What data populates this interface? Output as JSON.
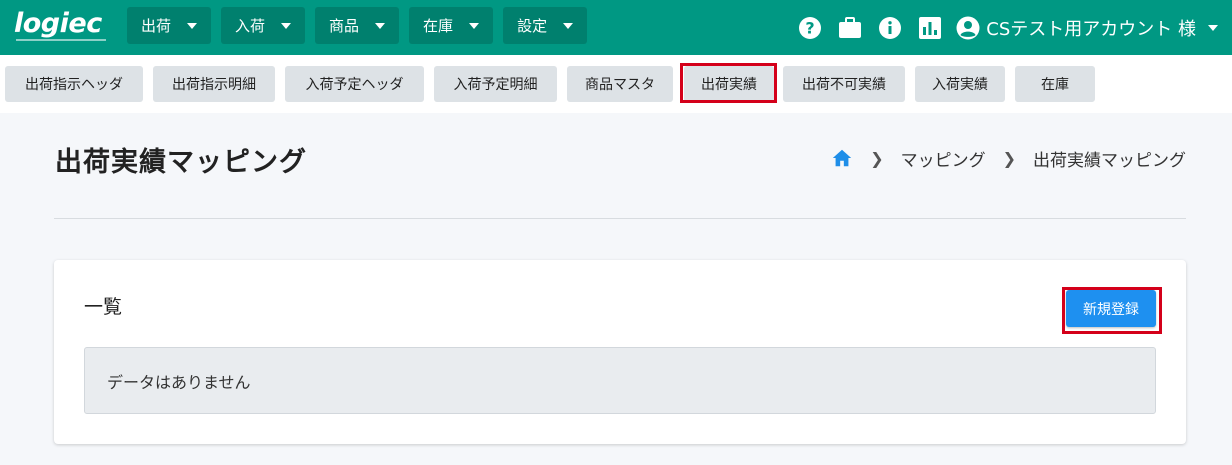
{
  "header": {
    "logo_text": "logiec",
    "menu": [
      {
        "label": "出荷"
      },
      {
        "label": "入荷"
      },
      {
        "label": "商品"
      },
      {
        "label": "在庫"
      },
      {
        "label": "設定"
      }
    ],
    "icons": [
      "help-icon",
      "briefcase-icon",
      "info-icon",
      "chart-icon",
      "account-icon"
    ],
    "user_name": "CSテスト用アカウント 様",
    "colors": {
      "bar": "#009883",
      "menu": "#00806e"
    }
  },
  "subtabs": [
    {
      "label": "出荷指示ヘッダ"
    },
    {
      "label": "出荷指示明細"
    },
    {
      "label": "入荷予定ヘッダ"
    },
    {
      "label": "入荷予定明細"
    },
    {
      "label": "商品マスタ"
    },
    {
      "label": "出荷実績",
      "highlighted": true
    },
    {
      "label": "出荷不可実績"
    },
    {
      "label": "入荷実績"
    },
    {
      "label": "在庫"
    }
  ],
  "page": {
    "title": "出荷実績マッピング",
    "breadcrumb": [
      "マッピング",
      "出荷実績マッピング"
    ]
  },
  "card": {
    "title": "一覧",
    "new_button": "新規登録",
    "empty_message": "データはありません"
  }
}
